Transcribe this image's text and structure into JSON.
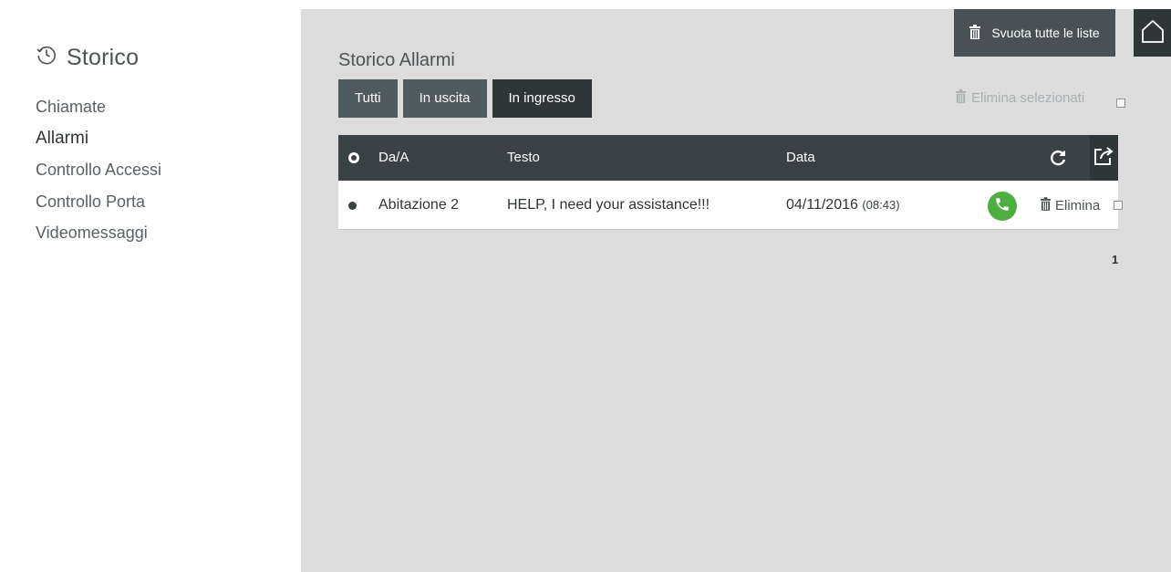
{
  "sidebar": {
    "title": "Storico",
    "items": [
      {
        "label": "Chiamate",
        "active": false
      },
      {
        "label": "Allarmi",
        "active": true
      },
      {
        "label": "Controllo Accessi",
        "active": false
      },
      {
        "label": "Controllo Porta",
        "active": false
      },
      {
        "label": "Videomessaggi",
        "active": false
      }
    ]
  },
  "header": {
    "clear_all_label": "Svuota tutte le liste",
    "home_icon": "home-icon"
  },
  "main": {
    "title": "Storico Allarmi",
    "tabs": [
      {
        "label": "Tutti",
        "active": false
      },
      {
        "label": "In uscita",
        "active": false
      },
      {
        "label": "In ingresso",
        "active": true
      }
    ],
    "delete_selected_label": "Elimina selezionati"
  },
  "table": {
    "columns": [
      "Da/A",
      "Testo",
      "Data"
    ],
    "rows": [
      {
        "from": "Abitazione 2",
        "text": "HELP, I need your assistance!!!",
        "date": "04/11/2016",
        "time": "(08:43)",
        "delete_label": "Elimina"
      }
    ]
  },
  "pagination": {
    "current_page": "1"
  },
  "colors": {
    "sidebar_bg": "#ffffff",
    "main_bg": "#dcdcdc",
    "header_dark": "#3a4245",
    "button_dark": "#2f3638",
    "button_gray": "#4f5b5f",
    "call_green": "#4caf3f"
  }
}
